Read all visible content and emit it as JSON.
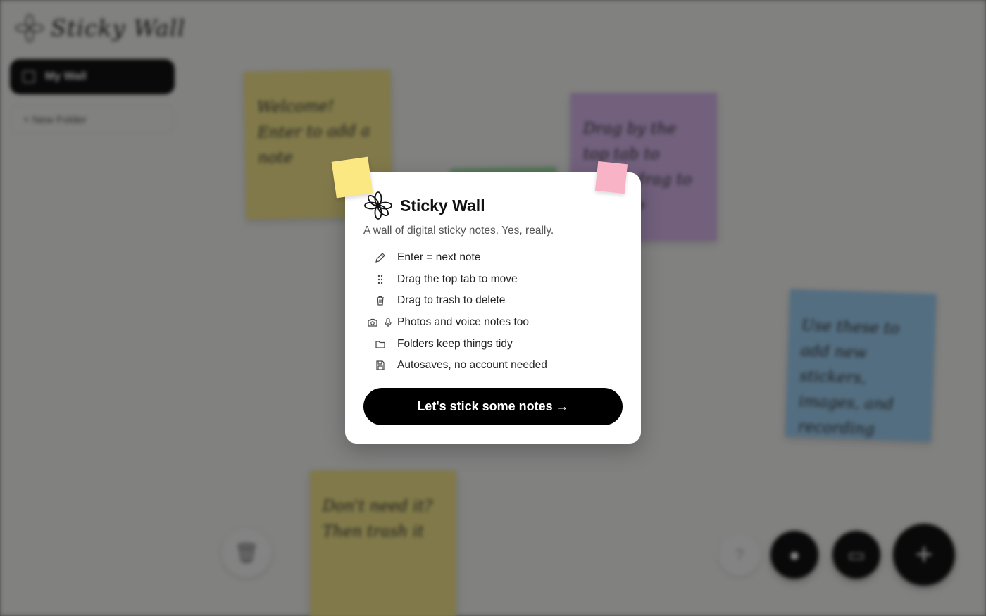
{
  "app": {
    "title": "Sticky Wall",
    "wall_button": "My Wall",
    "new_folder": "+ New Folder"
  },
  "notes": [
    {
      "text": "Welcome! Enter to add a note",
      "color": "#f3e58c"
    },
    {
      "text": "Drag by the top tab to move, drag to trash to",
      "color": "#d7b6ec"
    },
    {
      "text": "Use these to add new stickers, images, and recording",
      "color": "#9fd0f3"
    },
    {
      "text": "Don't need it? Then trash it",
      "color": "#f3e58c"
    }
  ],
  "modal": {
    "title": "Sticky Wall",
    "subtitle": "A wall of digital sticky notes. Yes, really.",
    "tips": [
      {
        "icon": "pencil-icon",
        "text": "Enter = next note"
      },
      {
        "icon": "drag-handle-icon",
        "text": "Drag the top tab to move"
      },
      {
        "icon": "trash-icon",
        "text": "Drag to trash to delete"
      },
      {
        "icon": "camera-mic-icon",
        "text": "Photos and voice notes too"
      },
      {
        "icon": "folder-icon",
        "text": "Folders keep things tidy"
      },
      {
        "icon": "save-icon",
        "text": "Autosaves, no account needed"
      }
    ],
    "cta": "Let's stick some notes →"
  },
  "colors": {
    "accent": "#000000",
    "sticker_yellow": "#fbe883",
    "sticker_pink": "#f8b4c6"
  }
}
